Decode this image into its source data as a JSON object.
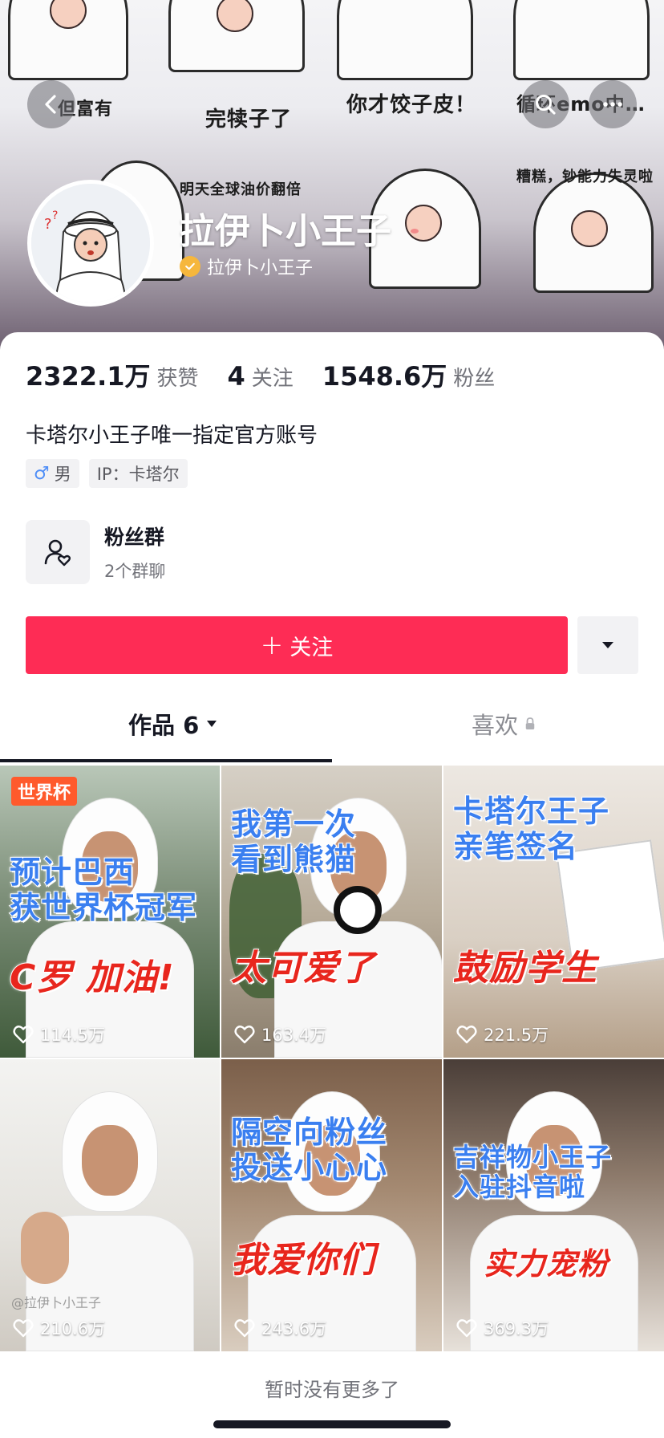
{
  "header": {
    "banner_captions": [
      "但富有",
      "完犊子了",
      "你才饺子皮！",
      "循环emo中…",
      "明天全球油价翻倍",
      "糟糕，钞能力失灵啦"
    ],
    "display_name": "拉伊卜小王子",
    "verified_name": "拉伊卜小王子"
  },
  "stats": {
    "likes_value": "2322.1万",
    "likes_label": "获赞",
    "following_value": "4",
    "following_label": "关注",
    "fans_value": "1548.6万",
    "fans_label": "粉丝"
  },
  "bio": "卡塔尔小王子唯一指定官方账号",
  "tags": {
    "gender_symbol": "♂",
    "gender": "男",
    "ip": "IP：卡塔尔"
  },
  "fan_group": {
    "title": "粉丝群",
    "subtitle": "2个群聊"
  },
  "actions": {
    "follow_label": "关注"
  },
  "tabs": {
    "works_label": "作品 6",
    "likes_label": "喜欢"
  },
  "videos": [
    {
      "badge": "世界杯",
      "blue_text": "预计巴西\n获世界杯冠军",
      "red_text": "C罗 加油!",
      "likes": "114.5万"
    },
    {
      "blue_text": "我第一次\n看到熊猫",
      "red_text": "太可爱了",
      "likes": "163.4万"
    },
    {
      "blue_text": "卡塔尔王子\n亲笔签名",
      "red_text": "鼓励学生",
      "likes": "221.5万"
    },
    {
      "watermark": "@拉伊卜小王子",
      "likes": "210.6万"
    },
    {
      "blue_text": "隔空向粉丝\n投送小心心",
      "red_text": "我爱你们",
      "likes": "243.6万"
    },
    {
      "blue_text": "吉祥物小王子\n入驻抖音啦",
      "red_text": "实力宠粉",
      "likes": "369.3万"
    }
  ],
  "footer": {
    "no_more": "暂时没有更多了"
  },
  "colors": {
    "accent": "#fe2c55",
    "verified": "#f6b73c",
    "cover_blue": "#3a7ff0",
    "cover_red": "#e8261d"
  }
}
